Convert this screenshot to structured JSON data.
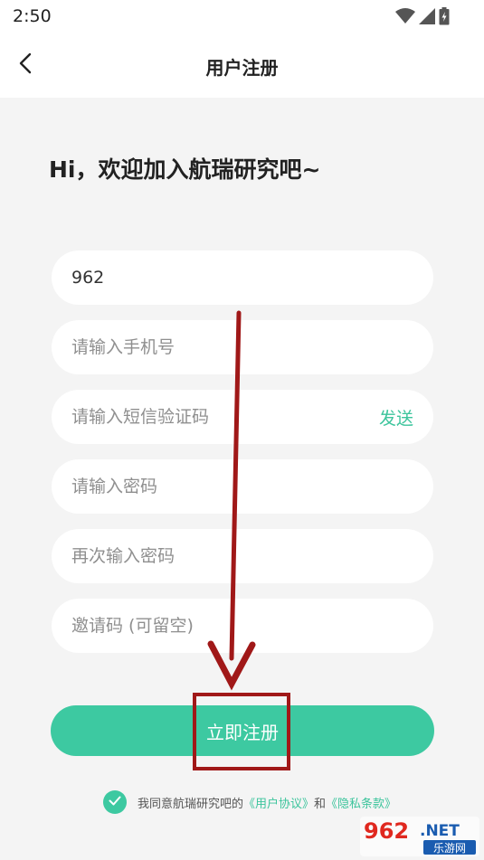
{
  "status_bar": {
    "time": "2:50"
  },
  "header": {
    "title": "用户注册"
  },
  "welcome_text": "Hi，欢迎加入航瑞研究吧~",
  "form": {
    "username_value": "962",
    "phone_placeholder": "请输入手机号",
    "sms_code_placeholder": "请输入短信验证码",
    "send_label": "发送",
    "password_placeholder": "请输入密码",
    "confirm_password_placeholder": "再次输入密码",
    "invite_placeholder": "邀请码 (可留空)"
  },
  "submit_label": "立即注册",
  "agreement": {
    "prefix": "我同意航瑞研究吧的",
    "user_agreement": "《用户协议》",
    "joiner": "和",
    "privacy_policy": "《隐私条款》"
  },
  "watermark": {
    "brand": "962",
    "suffix": ".NET",
    "caption": "乐游网"
  },
  "colors": {
    "accent": "#3dc9a1",
    "annotation_red": "#a01818",
    "background": "#f4f4f4"
  }
}
